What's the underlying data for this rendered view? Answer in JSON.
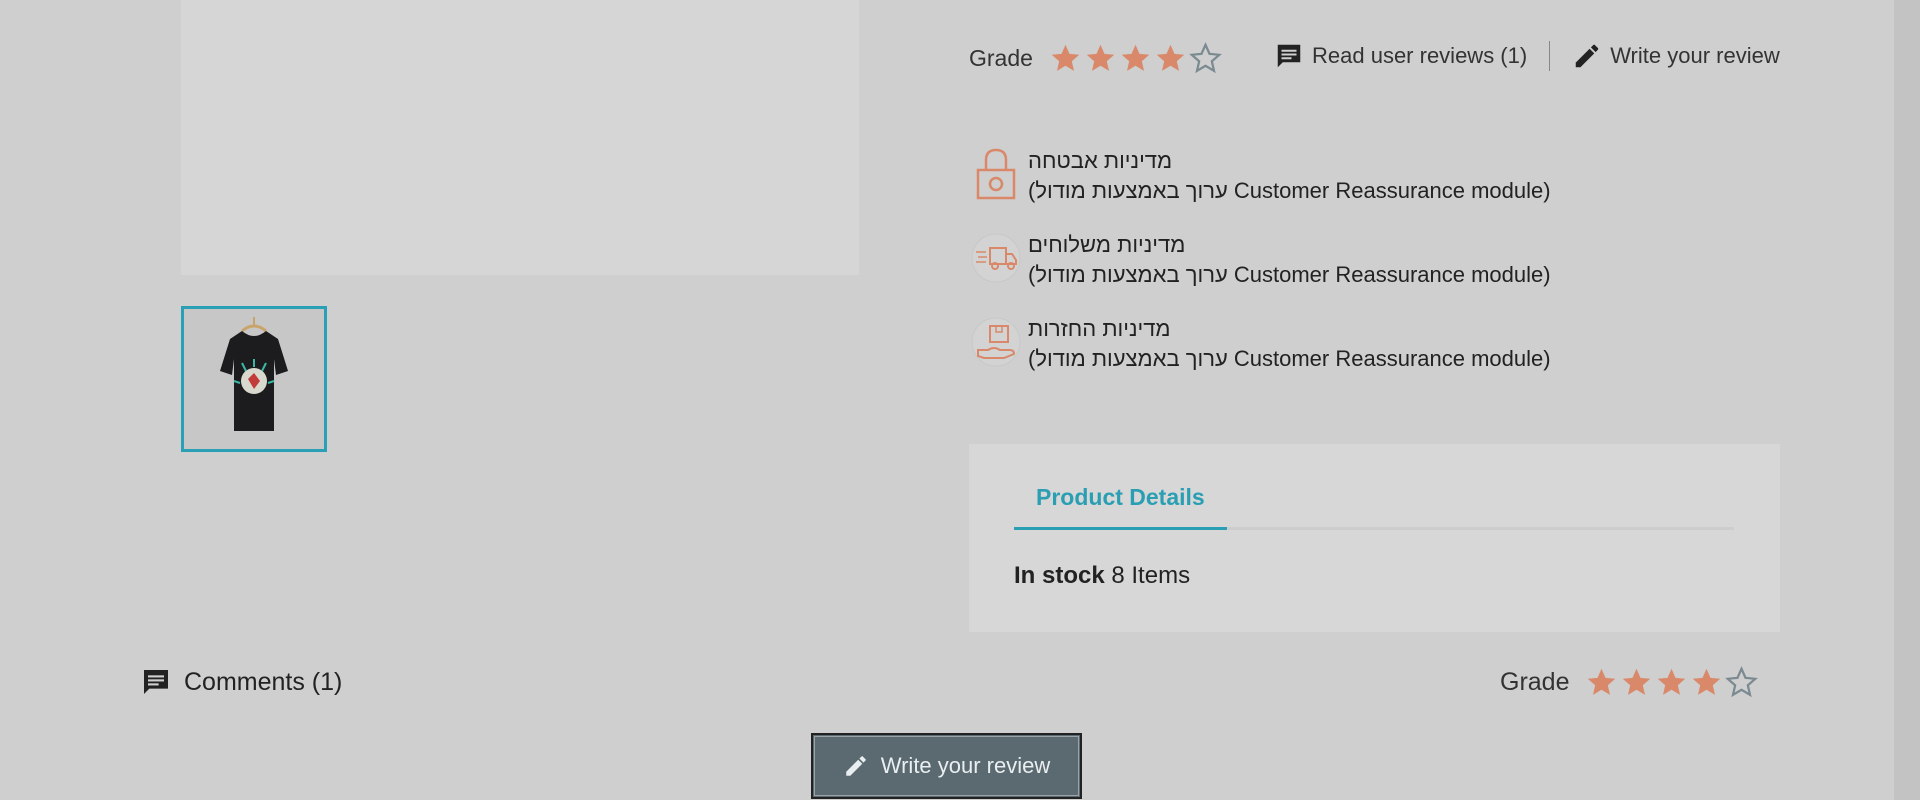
{
  "product": {
    "grade_label": "Grade",
    "rating": 4,
    "max_rating": 5,
    "read_reviews_label": "Read user reviews (1)",
    "write_review_label": "Write your review"
  },
  "reassurance": [
    {
      "icon": "lock-icon",
      "title": "מדיניות אבטחה",
      "desc": "(ערוך באמצעות מודול Customer Reassurance module)"
    },
    {
      "icon": "delivery-truck-icon",
      "title": "מדיניות משלוחים",
      "desc": "(ערוך באמצעות מודול Customer Reassurance module)"
    },
    {
      "icon": "return-package-icon",
      "title": "מדיניות החזרות",
      "desc": "(ערוך באמצעות מודול Customer Reassurance module)"
    }
  ],
  "details": {
    "tab_label": "Product Details",
    "stock_label": "In stock",
    "stock_value": "8 Items"
  },
  "comments": {
    "label": "Comments (1)",
    "grade_label": "Grade",
    "write_button_label": "Write your review"
  },
  "colors": {
    "star_filled": "#d9896a",
    "star_empty_stroke": "#7a8a90",
    "accent": "#2aa0b6",
    "button_bg": "#5b6a70"
  }
}
